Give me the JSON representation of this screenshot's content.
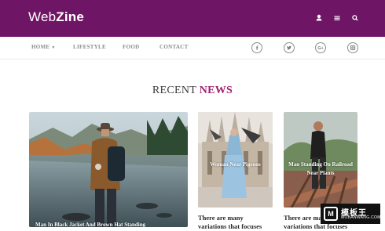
{
  "brand": {
    "logo_light": "Web",
    "logo_bold": "Zine"
  },
  "header_icons": [
    "user-icon",
    "menu-icon",
    "search-icon"
  ],
  "nav": {
    "items": [
      {
        "label": "HOME",
        "has_dropdown": true
      },
      {
        "label": "LIFESTYLE"
      },
      {
        "label": "FOOD"
      },
      {
        "label": "CONTACT"
      }
    ],
    "social_icons": [
      "facebook-icon",
      "twitter-icon",
      "google-plus-icon",
      "instagram-icon"
    ]
  },
  "section": {
    "title_plain": "RECENT",
    "title_accent": "NEWS"
  },
  "posts": [
    {
      "title": "Man In Black Jacket And Brown Hat Standing"
    },
    {
      "title_plain": "Woman Near",
      "title_highlight": "Pigeons",
      "excerpt": "There are many variations that focuses"
    },
    {
      "title": "Man Standing On Railroad Near Plants",
      "excerpt": "There are many variations that focuses"
    }
  ],
  "watermark": {
    "mark": "M",
    "line1": "模板王",
    "line2": "MOBANWANG.COM"
  },
  "colors": {
    "header_bg": "#6f1565",
    "accent": "#a0216f"
  }
}
